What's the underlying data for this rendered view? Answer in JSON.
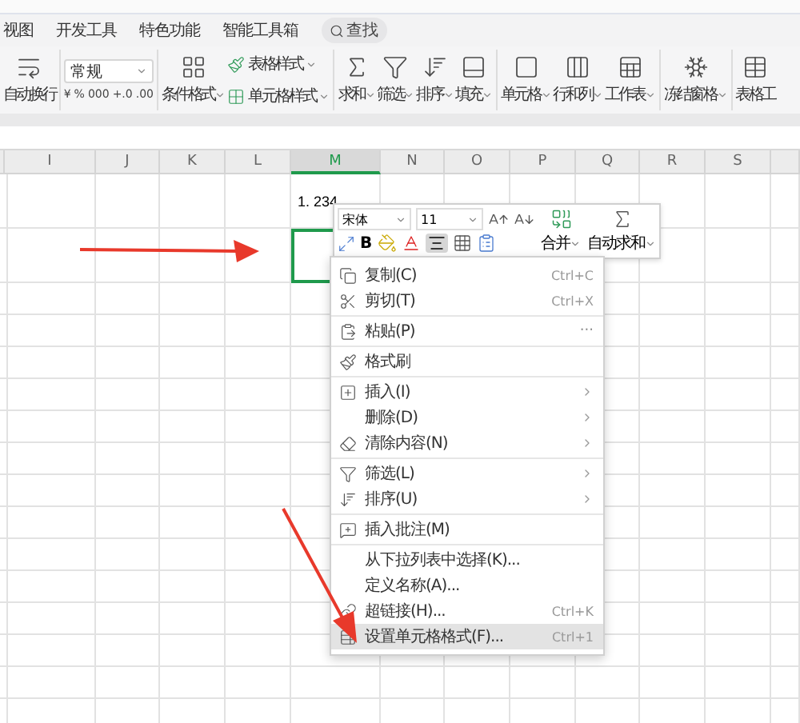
{
  "tabs": [
    {
      "label": "视图",
      "selected": false
    },
    {
      "label": "开发工具",
      "selected": false
    },
    {
      "label": "特色功能",
      "selected": false
    },
    {
      "label": "智能工具箱",
      "selected": false
    }
  ],
  "search": {
    "label": "查找"
  },
  "ribbon": [
    [
      {
        "kind": "large",
        "label": "自动换行",
        "dropdown": false
      }
    ],
    [
      {
        "kind": "format",
        "value": "常规",
        "buttons": [
          "¥",
          "%",
          "000",
          "+.0",
          ".00"
        ]
      }
    ],
    [
      {
        "kind": "large",
        "label": "条件格式",
        "dropdown": true
      },
      {
        "kind": "stack",
        "items": [
          {
            "label": "表格样式",
            "dropdown": true
          },
          {
            "label": "单元格样式",
            "dropdown": true
          }
        ]
      }
    ],
    [
      {
        "kind": "large",
        "label": "求和",
        "dropdown": true
      },
      {
        "kind": "large",
        "label": "筛选",
        "dropdown": true
      },
      {
        "kind": "large",
        "label": "排序",
        "dropdown": true
      },
      {
        "kind": "large",
        "label": "填充",
        "dropdown": true
      }
    ],
    [
      {
        "kind": "large",
        "label": "单元格",
        "dropdown": true
      },
      {
        "kind": "large",
        "label": "行和列",
        "dropdown": true
      },
      {
        "kind": "large",
        "label": "工作表",
        "dropdown": true
      }
    ],
    [
      {
        "kind": "large",
        "label": "冻结窗格",
        "dropdown": true
      }
    ],
    [
      {
        "kind": "large",
        "label": "表格工",
        "dropdown": false
      }
    ]
  ],
  "columns": [
    {
      "label": "I",
      "selected": false
    },
    {
      "label": "J",
      "selected": false
    },
    {
      "label": "K",
      "selected": false
    },
    {
      "label": "L",
      "selected": false
    },
    {
      "label": "M",
      "selected": true
    },
    {
      "label": "N",
      "selected": false
    },
    {
      "label": "O",
      "selected": false
    },
    {
      "label": "P",
      "selected": false
    },
    {
      "label": "Q",
      "selected": false
    },
    {
      "label": "R",
      "selected": false
    },
    {
      "label": "S",
      "selected": false
    }
  ],
  "cell_text": "1. 234",
  "active_cell": {
    "selected": true
  },
  "mini_toolbar": {
    "font": "宋体",
    "size": "11",
    "bold": "B",
    "align_pressed": true,
    "merge": "合并",
    "autosum": "自动求和"
  },
  "menu": [
    [
      {
        "label": "复制(C)",
        "shortcut": "Ctrl+C",
        "submenu": false,
        "selected": false
      },
      {
        "label": "剪切(T)",
        "shortcut": "Ctrl+X",
        "submenu": false,
        "selected": false
      }
    ],
    [
      {
        "label": "粘贴(P)",
        "submenu": false,
        "selected": false,
        "extra": "···"
      }
    ],
    [
      {
        "label": "格式刷",
        "submenu": false,
        "selected": false
      }
    ],
    [
      {
        "label": "插入(I)",
        "submenu": true,
        "selected": false
      },
      {
        "label": "删除(D)",
        "submenu": true,
        "selected": false
      },
      {
        "label": "清除内容(N)",
        "submenu": true,
        "selected": false
      }
    ],
    [
      {
        "label": "筛选(L)",
        "submenu": true,
        "selected": false
      },
      {
        "label": "排序(U)",
        "submenu": true,
        "selected": false
      }
    ],
    [
      {
        "label": "插入批注(M)",
        "submenu": false,
        "selected": false
      }
    ],
    [
      {
        "label": "从下拉列表中选择(K)...",
        "submenu": false,
        "selected": false
      },
      {
        "label": "定义名称(A)...",
        "submenu": false,
        "selected": false
      },
      {
        "label": "超链接(H)...",
        "shortcut": "Ctrl+K",
        "submenu": false,
        "selected": false
      },
      {
        "label": "设置单元格格式(F)...",
        "shortcut": "Ctrl+1",
        "submenu": false,
        "selected": true
      }
    ]
  ],
  "annotations": [
    {
      "kind": "arrow"
    },
    {
      "kind": "arrow"
    }
  ]
}
